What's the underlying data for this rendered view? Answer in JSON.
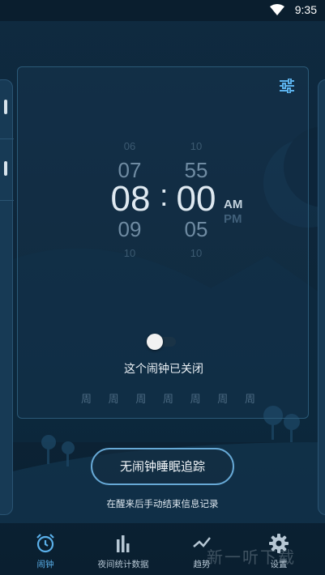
{
  "status": {
    "time": "9:35"
  },
  "picker": {
    "hours": [
      "06",
      "07",
      "08",
      "09",
      "10"
    ],
    "minutes": [
      "10",
      "55",
      "00",
      "05",
      "10"
    ],
    "am": "AM",
    "pm": "PM",
    "colon": ":"
  },
  "alarm": {
    "status_text": "这个闹钟已关闭",
    "enabled": false
  },
  "weekdays": [
    "周",
    "周",
    "周",
    "周",
    "周",
    "周",
    "周"
  ],
  "sleep_tracking": {
    "button_label": "无闹钟睡眠追踪",
    "hint": "在醒来后手动结束信息记录"
  },
  "nav": {
    "items": [
      {
        "label": "闹钟",
        "icon": "alarm-clock-icon",
        "active": true
      },
      {
        "label": "夜间统计数据",
        "icon": "bar-chart-icon",
        "active": false
      },
      {
        "label": "趋势",
        "icon": "trend-icon",
        "active": false
      },
      {
        "label": "设置",
        "icon": "gear-icon",
        "active": false
      }
    ]
  },
  "watermark": "新一听下载",
  "colors": {
    "accent": "#5ab0ea",
    "background": "#0f2a40"
  }
}
